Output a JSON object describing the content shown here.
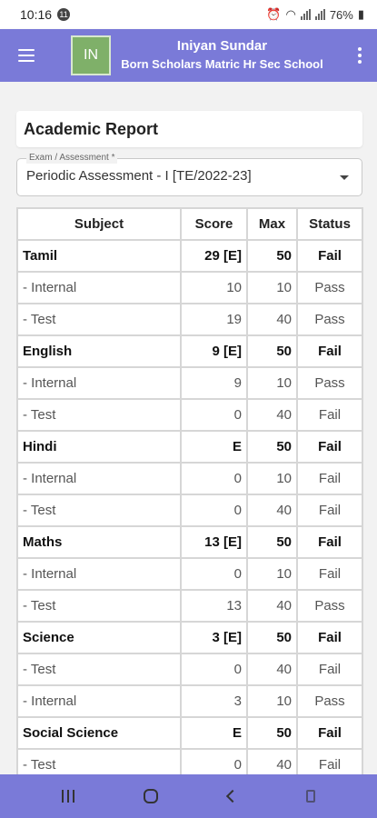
{
  "status_bar": {
    "time": "10:16",
    "notif_badge": "11",
    "battery": "76%"
  },
  "app_bar": {
    "avatar_initials": "IN",
    "title": "Iniyan Sundar",
    "subtitle": "Born Scholars Matric Hr Sec School",
    "brand_color": "#7a7ad8"
  },
  "page": {
    "title": "Academic Report"
  },
  "exam_select": {
    "label": "Exam / Assessment *",
    "value": "Periodic Assessment - I [TE/2022-23]"
  },
  "table": {
    "headers": {
      "subject": "Subject",
      "score": "Score",
      "max": "Max",
      "status": "Status"
    },
    "rows": [
      {
        "type": "main",
        "subject": "Tamil",
        "score": "29 [E]",
        "max": "50",
        "status": "Fail"
      },
      {
        "type": "sub",
        "subject": "- Internal",
        "score": "10",
        "max": "10",
        "status": "Pass"
      },
      {
        "type": "sub",
        "subject": "- Test",
        "score": "19",
        "max": "40",
        "status": "Pass"
      },
      {
        "type": "main",
        "subject": "English",
        "score": "9 [E]",
        "max": "50",
        "status": "Fail"
      },
      {
        "type": "sub",
        "subject": "- Internal",
        "score": "9",
        "max": "10",
        "status": "Pass"
      },
      {
        "type": "sub",
        "subject": "- Test",
        "score": "0",
        "max": "40",
        "status": "Fail"
      },
      {
        "type": "main",
        "subject": "Hindi",
        "score": "E",
        "max": "50",
        "status": "Fail"
      },
      {
        "type": "sub",
        "subject": "- Internal",
        "score": "0",
        "max": "10",
        "status": "Fail"
      },
      {
        "type": "sub",
        "subject": "- Test",
        "score": "0",
        "max": "40",
        "status": "Fail"
      },
      {
        "type": "main",
        "subject": "Maths",
        "score": "13 [E]",
        "max": "50",
        "status": "Fail"
      },
      {
        "type": "sub",
        "subject": "- Internal",
        "score": "0",
        "max": "10",
        "status": "Fail"
      },
      {
        "type": "sub",
        "subject": "- Test",
        "score": "13",
        "max": "40",
        "status": "Pass"
      },
      {
        "type": "main",
        "subject": "Science",
        "score": "3 [E]",
        "max": "50",
        "status": "Fail"
      },
      {
        "type": "sub",
        "subject": "- Test",
        "score": "0",
        "max": "40",
        "status": "Fail"
      },
      {
        "type": "sub",
        "subject": "- Internal",
        "score": "3",
        "max": "10",
        "status": "Pass"
      },
      {
        "type": "main",
        "subject": "Social Science",
        "score": "E",
        "max": "50",
        "status": "Fail"
      },
      {
        "type": "sub",
        "subject": "- Test",
        "score": "0",
        "max": "40",
        "status": "Fail"
      }
    ]
  }
}
